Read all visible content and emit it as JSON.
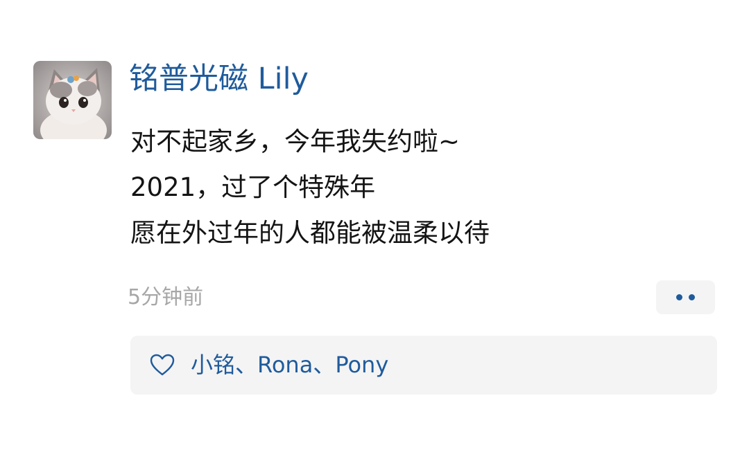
{
  "post": {
    "author": "铭普光磁 Lily",
    "lines": [
      "对不起家乡，今年我失约啦~",
      "2021，过了个特殊年",
      "愿在外过年的人都能被温柔以待"
    ],
    "timestamp": "5分钟前",
    "avatar_icon": "kitten-avatar"
  },
  "likes": {
    "icon": "heart-outline-icon",
    "names": [
      "小铭",
      "Rona",
      "Pony"
    ],
    "separator": "、"
  },
  "more_button": {
    "icon": "more-dots-icon"
  },
  "colors": {
    "link_blue": "#1f5b9c",
    "text": "#141414",
    "muted": "#a7a7a7",
    "panel_bg": "#f4f4f4"
  }
}
